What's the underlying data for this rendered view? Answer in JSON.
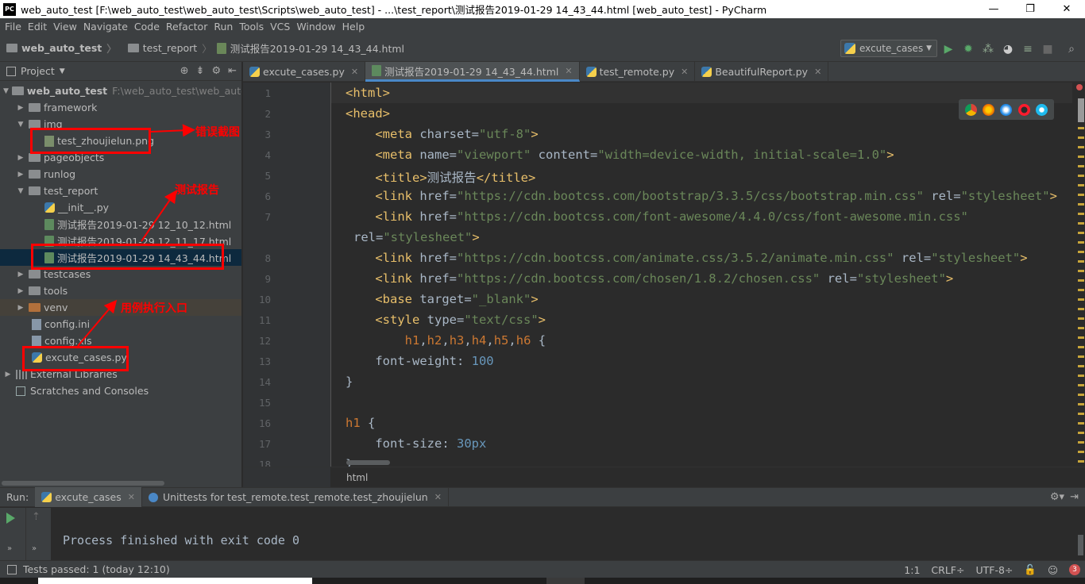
{
  "window": {
    "logo": "PC",
    "title": "web_auto_test [F:\\web_auto_test\\web_auto_test\\Scripts\\web_auto_test] - ...\\test_report\\测试报告2019-01-29 14_43_44.html [web_auto_test] - PyCharm",
    "minimize": "—",
    "restore": "❐",
    "close": "✕"
  },
  "menu": [
    "File",
    "Edit",
    "View",
    "Navigate",
    "Code",
    "Refactor",
    "Run",
    "Tools",
    "VCS",
    "Window",
    "Help"
  ],
  "navbar": {
    "root": "web_auto_test",
    "folder": "test_report",
    "file": "测试报告2019-01-29 14_43_44.html",
    "run_config": "excute_cases"
  },
  "project_panel": {
    "title": "Project",
    "tree": [
      {
        "label": "web_auto_test",
        "extra": "F:\\web_auto_test\\web_auto_tes"
      },
      {
        "label": "framework"
      },
      {
        "label": "img"
      },
      {
        "label": "test_zhoujielun.png"
      },
      {
        "label": "pageobjects"
      },
      {
        "label": "runlog"
      },
      {
        "label": "test_report"
      },
      {
        "label": "__init__.py"
      },
      {
        "label": "测试报告2019-01-29 12_10_12.html"
      },
      {
        "label": "测试报告2019-01-29 12_11_17.html"
      },
      {
        "label": "测试报告2019-01-29 14_43_44.html"
      },
      {
        "label": "testcases"
      },
      {
        "label": "tools"
      },
      {
        "label": "venv"
      },
      {
        "label": "config.ini"
      },
      {
        "label": "config.xls"
      },
      {
        "label": "excute_cases.py"
      },
      {
        "label": "External Libraries"
      },
      {
        "label": "Scratches and Consoles"
      }
    ]
  },
  "annotations": {
    "error_screenshot": "错误截图",
    "test_report": "测试报告",
    "entry": "用例执行入口"
  },
  "editor_tabs": [
    {
      "label": "excute_cases.py"
    },
    {
      "label": "测试报告2019-01-29 14_43_44.html"
    },
    {
      "label": "test_remote.py"
    },
    {
      "label": "BeautifulReport.py"
    }
  ],
  "line_numbers": [
    "1",
    "2",
    "3",
    "4",
    "5",
    "6",
    "7",
    "",
    "8",
    "9",
    "10",
    "11",
    "12",
    "13",
    "14",
    "15",
    "16",
    "17",
    "18"
  ],
  "code_lines": [
    {
      "t": "<html>"
    },
    {
      "t": "<head>"
    },
    {
      "t": "    <meta charset=\"utf-8\">"
    },
    {
      "t": "    <meta name=\"viewport\" content=\"width=device-width, initial-scale=1.0\">"
    },
    {
      "t": "    <title>测试报告</title>"
    },
    {
      "t": "    <link href=\"https://cdn.bootcss.com/bootstrap/3.3.5/css/bootstrap.min.css\" rel=\"stylesheet\">"
    },
    {
      "t": "    <link href=\"https://cdn.bootcss.com/font-awesome/4.4.0/css/font-awesome.min.css\""
    },
    {
      "t": "rel=\"stylesheet\">"
    },
    {
      "t": "    <link href=\"https://cdn.bootcss.com/animate.css/3.5.2/animate.min.css\" rel=\"stylesheet\">"
    },
    {
      "t": "    <link href=\"https://cdn.bootcss.com/chosen/1.8.2/chosen.css\" rel=\"stylesheet\">"
    },
    {
      "t": "    <base target=\"_blank\">"
    },
    {
      "t": "    <style type=\"text/css\">"
    },
    {
      "t": "        h1,h2,h3,h4,h5,h6 {"
    },
    {
      "t": "    font-weight: 100"
    },
    {
      "t": "}"
    },
    {
      "t": ""
    },
    {
      "t": "h1 {"
    },
    {
      "t": "    font-size: 30px"
    },
    {
      "t": "}"
    }
  ],
  "editor_breadcrumb": "html",
  "run_panel": {
    "label": "Run:",
    "tabs": [
      {
        "label": "excute_cases"
      },
      {
        "label": "Unittests for test_remote.test_remote.test_zhoujielun"
      }
    ],
    "output": "Process finished with exit code 0"
  },
  "status": {
    "tests": "Tests passed: 1 (today 12:10)",
    "position": "1:1",
    "line_sep": "CRLF÷",
    "encoding": "UTF-8÷",
    "badge": "3"
  },
  "colors": {
    "accent": "#4a88c7",
    "annotation": "#ff0000",
    "tag": "#e8bf6a",
    "string": "#6a8759",
    "number": "#6897bb"
  }
}
